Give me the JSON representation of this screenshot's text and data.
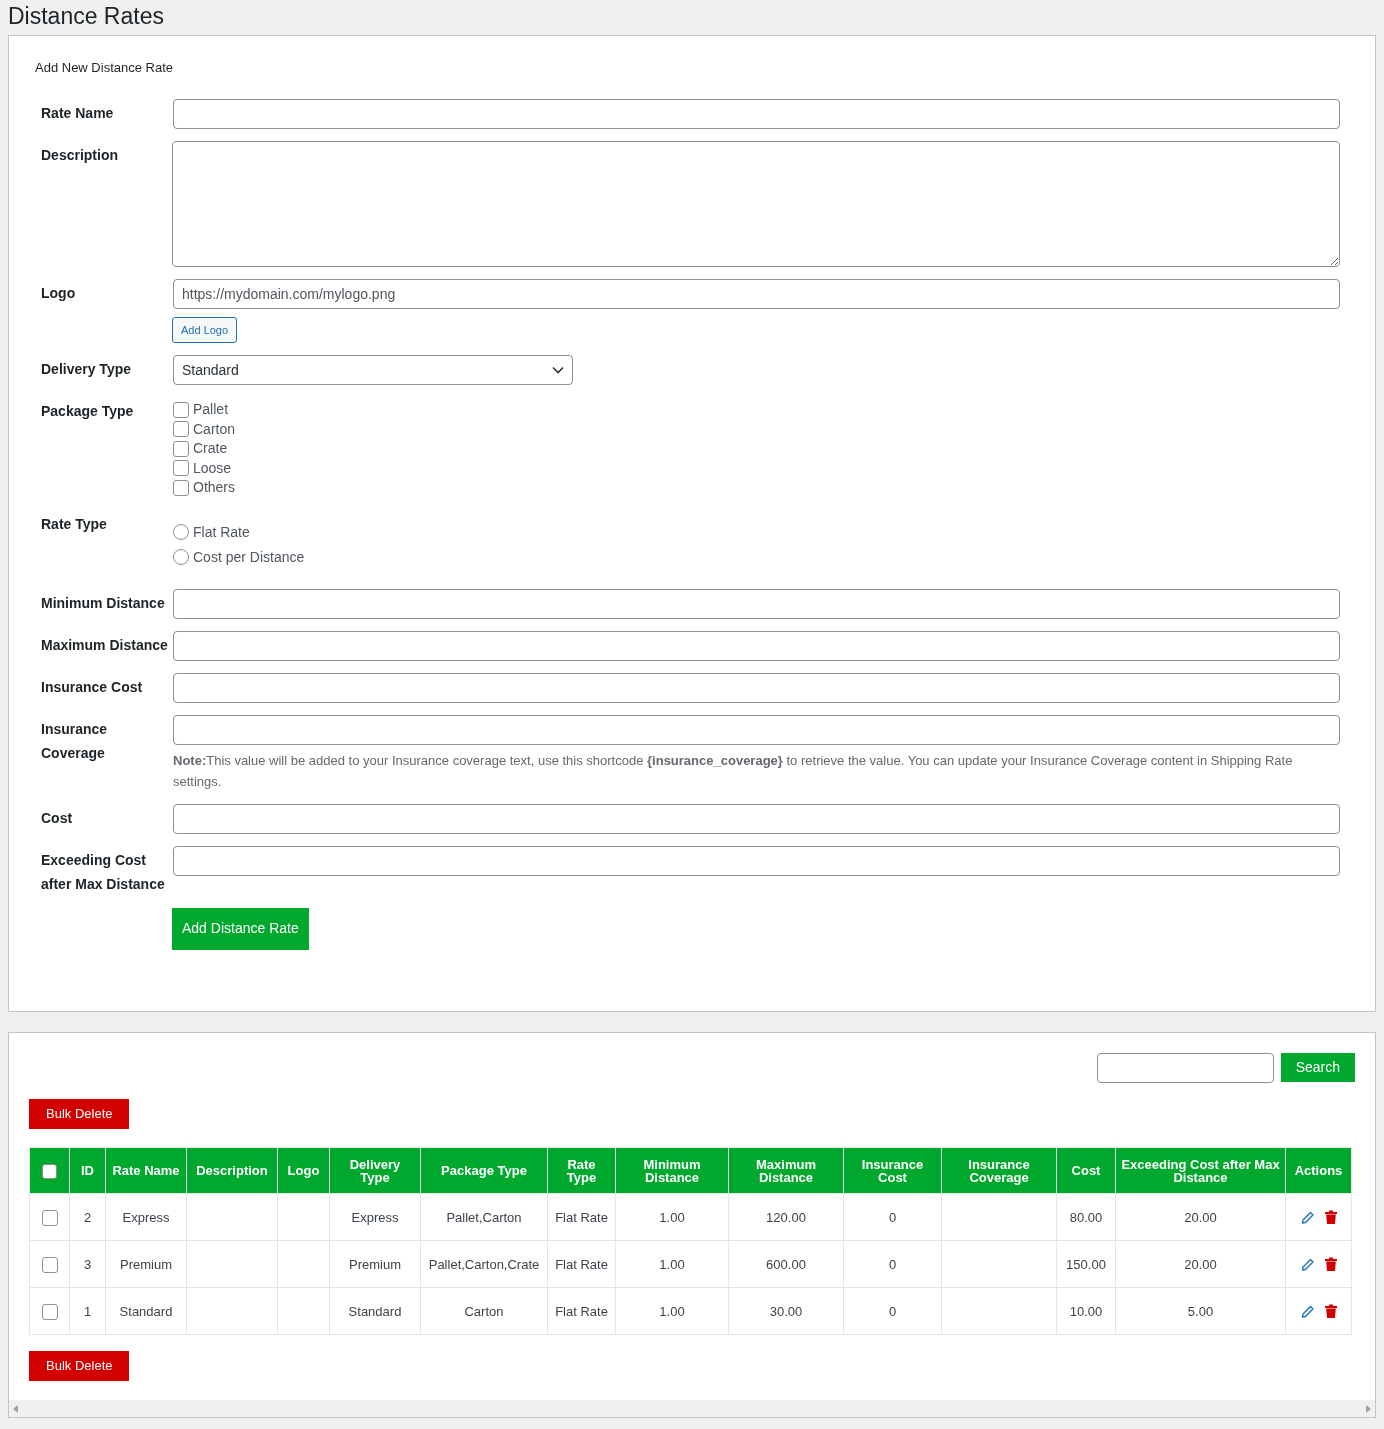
{
  "page_title": "Distance Rates",
  "form": {
    "title": "Add New Distance Rate",
    "fields": [
      {
        "kind": "text",
        "label": "Rate Name"
      },
      {
        "kind": "textarea",
        "label": "Description"
      },
      {
        "kind": "logo",
        "label": "Logo",
        "placeholder": "https://mydomain.com/mylogo.png",
        "button": "Add Logo"
      },
      {
        "kind": "select",
        "label": "Delivery Type",
        "value": "Standard"
      },
      {
        "kind": "checkboxes",
        "label": "Package Type",
        "options": [
          {
            "label": "Pallet",
            "checked": false
          },
          {
            "label": "Carton",
            "checked": false
          },
          {
            "label": "Crate",
            "checked": false
          },
          {
            "label": "Loose",
            "checked": false
          },
          {
            "label": "Others",
            "checked": false
          }
        ]
      },
      {
        "kind": "radios",
        "label": "Rate Type",
        "options": [
          {
            "label": "Flat Rate",
            "selected": false
          },
          {
            "label": "Cost per Distance",
            "selected": false
          }
        ]
      },
      {
        "kind": "text",
        "label": "Minimum Distance"
      },
      {
        "kind": "text",
        "label": "Maximum Distance"
      },
      {
        "kind": "text",
        "label": "Insurance Cost"
      },
      {
        "kind": "text",
        "label": "Insurance Coverage",
        "note": "**Note:**This value will be added to your Insurance coverage text, use this shortcode **{insurance_coverage}** to retrieve the value. You can update your Insurance Coverage content in Shipping Rate settings."
      },
      {
        "kind": "text",
        "label": "Cost"
      },
      {
        "kind": "text",
        "label": "Exceeding Cost after Max Distance"
      }
    ],
    "submit": "Add Distance Rate"
  },
  "list": {
    "search_button": "Search",
    "bulk_delete_top": "Bulk Delete",
    "bulk_delete_bottom": "Bulk Delete",
    "select_all_checked": false,
    "columns": [
      "ID",
      "Rate Name",
      "Description",
      "Logo",
      "Delivery Type",
      "Package Type",
      "Rate Type",
      "Minimum Distance",
      "Maximum Distance",
      "Insurance Cost",
      "Insurance Coverage",
      "Cost",
      "Exceeding Cost after Max Distance",
      "Actions"
    ],
    "rows": [
      {
        "checked": false,
        "cells": [
          "2",
          "Express",
          "",
          "",
          "Express",
          "Pallet,Carton",
          "Flat Rate",
          "1.00",
          "120.00",
          "0",
          "",
          "80.00",
          "20.00"
        ]
      },
      {
        "checked": false,
        "cells": [
          "3",
          "Premium",
          "",
          "",
          "Premium",
          "Pallet,Carton,Crate",
          "Flat Rate",
          "1.00",
          "600.00",
          "0",
          "",
          "150.00",
          "20.00"
        ]
      },
      {
        "checked": false,
        "cells": [
          "1",
          "Standard",
          "",
          "",
          "Standard",
          "Carton",
          "Flat Rate",
          "1.00",
          "30.00",
          "0",
          "",
          "10.00",
          "5.00"
        ]
      }
    ]
  }
}
